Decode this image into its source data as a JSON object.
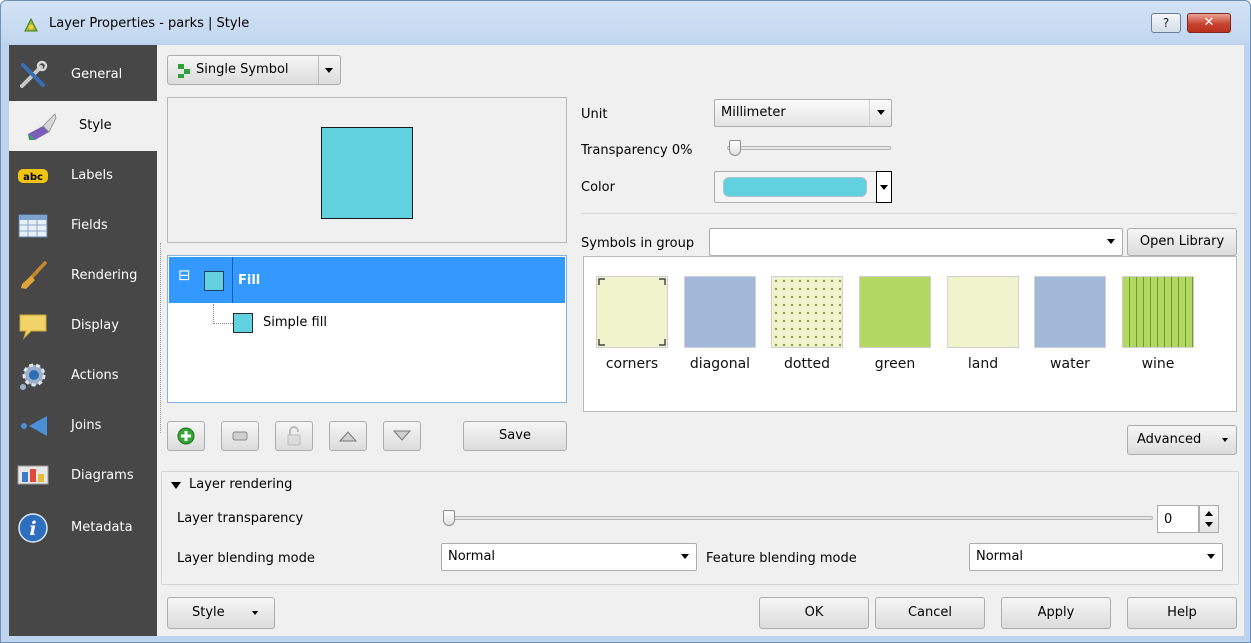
{
  "window": {
    "title": "Layer Properties - parks | Style",
    "help_label": "?",
    "close_label": "✕"
  },
  "sidebar": {
    "items": [
      {
        "label": "General",
        "icon": "tools-icon"
      },
      {
        "label": "Style",
        "icon": "brush-icon"
      },
      {
        "label": "Labels",
        "icon": "abc-icon"
      },
      {
        "label": "Fields",
        "icon": "table-icon"
      },
      {
        "label": "Rendering",
        "icon": "paintbrush-icon"
      },
      {
        "label": "Display",
        "icon": "speech-bubble-icon"
      },
      {
        "label": "Actions",
        "icon": "gear-icon"
      },
      {
        "label": "Joins",
        "icon": "join-arrow-icon"
      },
      {
        "label": "Diagrams",
        "icon": "diagram-icon"
      },
      {
        "label": "Metadata",
        "icon": "info-icon"
      }
    ],
    "active_index": 1
  },
  "renderer": {
    "type_label": "Single Symbol"
  },
  "colors": {
    "fill": "#62d1df",
    "selection": "#3399ff",
    "sidebar_bg": "#474747"
  },
  "symbol_tree": {
    "root_label": "Fill",
    "expand_glyph": "⊟",
    "child_label": "Simple fill"
  },
  "layer_buttons": {
    "save_label": "Save"
  },
  "symbol_props": {
    "unit_label": "Unit",
    "unit_value": "Millimeter",
    "transparency_label": "Transparency 0%",
    "transparency_value": 0,
    "color_label": "Color"
  },
  "library": {
    "group_label": "Symbols in group",
    "group_value": "",
    "open_library_label": "Open Library",
    "symbols": [
      {
        "name": "corners",
        "color": "#f0f4cc"
      },
      {
        "name": "diagonal",
        "color": "#a1b8d8"
      },
      {
        "name": "dotted",
        "color": "#f0f4cc"
      },
      {
        "name": "green",
        "color": "#b2d862"
      },
      {
        "name": "land",
        "color": "#f0f4cc"
      },
      {
        "name": "water",
        "color": "#a1b8d8"
      },
      {
        "name": "wine",
        "color": "#b2d862"
      }
    ],
    "advanced_label": "Advanced"
  },
  "layer_rendering": {
    "section_label": "Layer rendering",
    "transparency_label": "Layer transparency",
    "transparency_value": "0",
    "blending_label": "Layer blending mode",
    "blending_value": "Normal",
    "feature_blending_label": "Feature blending mode",
    "feature_blending_value": "Normal"
  },
  "footer": {
    "style_label": "Style",
    "ok_label": "OK",
    "cancel_label": "Cancel",
    "apply_label": "Apply",
    "help_label": "Help"
  }
}
